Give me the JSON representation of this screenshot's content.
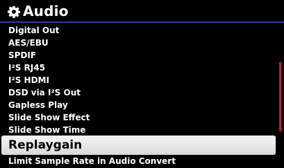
{
  "header": {
    "title": "Audio",
    "icon": "gear-icon"
  },
  "menu": {
    "items": [
      {
        "label": "Digital Out"
      },
      {
        "label": "AES/EBU"
      },
      {
        "label": "SPDIF"
      },
      {
        "label": "I²S RJ45"
      },
      {
        "label": "I²S HDMI"
      },
      {
        "label": "DSD via I²S Out"
      },
      {
        "label": "Gapless Play"
      },
      {
        "label": "Slide Show Effect"
      },
      {
        "label": "Slide Show Time"
      },
      {
        "label": "Replaygain"
      },
      {
        "label": "Limit Sample Rate in Audio Convert"
      }
    ],
    "selected_index": 9
  },
  "colors": {
    "background": "#000000",
    "header_border": "#2f3b93",
    "selection": "#e8e8e8",
    "scrollbar": "#c11f2e"
  }
}
